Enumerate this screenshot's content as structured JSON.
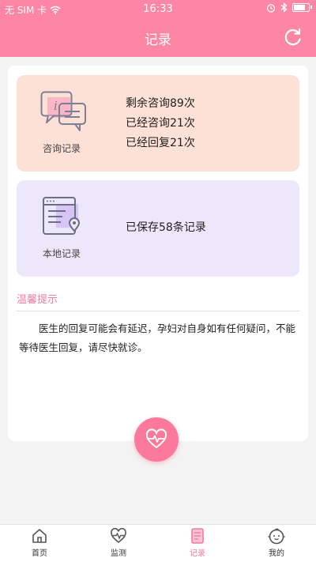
{
  "status_bar": {
    "carrier": "无 SIM 卡",
    "time": "16:33",
    "battery_level": 0.85,
    "icons": [
      "wifi-icon",
      "alarm-icon",
      "bluetooth-icon",
      "battery-icon"
    ]
  },
  "header": {
    "title": "记录",
    "refresh_icon": "refresh-icon"
  },
  "records": {
    "consult": {
      "icon": "consult-chat-icon",
      "caption": "咨询记录",
      "lines": [
        "剩余咨询89次",
        "已经咨询21次",
        "已经回复21次"
      ]
    },
    "local": {
      "icon": "local-record-icon",
      "caption": "本地记录",
      "lines": [
        "已保存58条记录"
      ]
    }
  },
  "tips": {
    "title": "温馨提示",
    "text": "医生的回复可能会有延迟，孕妇对自身如有任何疑问，不能等待医生回复，请尽快就诊。"
  },
  "fab": {
    "icon": "heart-rate-icon"
  },
  "tabs": [
    {
      "label": "首页",
      "icon": "home-icon",
      "active": false
    },
    {
      "label": "监测",
      "icon": "heart-monitor-icon",
      "active": false
    },
    {
      "label": "记录",
      "icon": "record-doc-icon",
      "active": true
    },
    {
      "label": "我的",
      "icon": "baby-face-icon",
      "active": false
    }
  ],
  "colors": {
    "primary": "#fc86a3",
    "consult_card": "#fde0d6",
    "local_card": "#ede7fb",
    "accent_text": "#f17ea0"
  }
}
